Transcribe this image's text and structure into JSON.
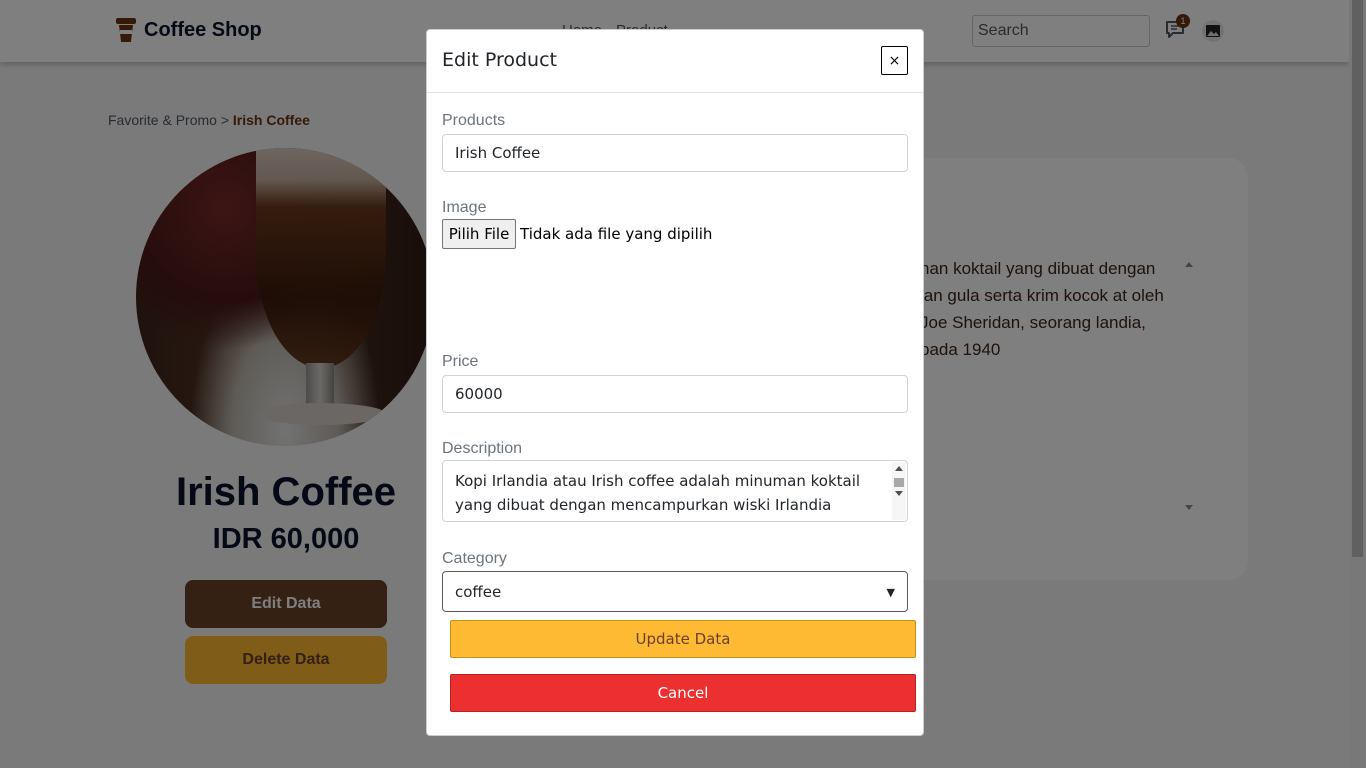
{
  "navbar": {
    "brand": "Coffee Shop",
    "links": [
      "Home",
      "Product"
    ],
    "search_placeholder": "Search",
    "chat_badge": "1"
  },
  "breadcrumb": {
    "parent": "Favorite & Promo",
    "separator": " > ",
    "current": "Irish Coffee"
  },
  "product": {
    "title": "Irish Coffee",
    "price": "IDR 60,000",
    "edit_label": "Edit Data",
    "delete_label": "Delete Data",
    "description_visible": "nan koktail yang dibuat dengan lan gula serta krim kocok at oleh Joe Sheridan, seorang landia, pada 1940"
  },
  "modal": {
    "title": "Edit Product",
    "close_label": "×",
    "products_label": "Products",
    "products_value": "Irish Coffee",
    "image_label": "Image",
    "file_button": "Pilih File",
    "file_status": "Tidak ada file yang dipilih",
    "price_label": "Price",
    "price_value": "60000",
    "description_label": "Description",
    "description_value": "Kopi Irlandia atau Irish coffee adalah minuman koktail yang dibuat dengan mencampurkan wiski Irlandia dengan kopi",
    "category_label": "Category",
    "category_value": "coffee",
    "update_label": "Update Data",
    "cancel_label": "Cancel"
  },
  "colors": {
    "brand_brown": "#6a4029",
    "accent_yellow": "#ffba33",
    "danger_red": "#ec3030",
    "backdrop": "rgba(0,0,0,0.5)"
  }
}
